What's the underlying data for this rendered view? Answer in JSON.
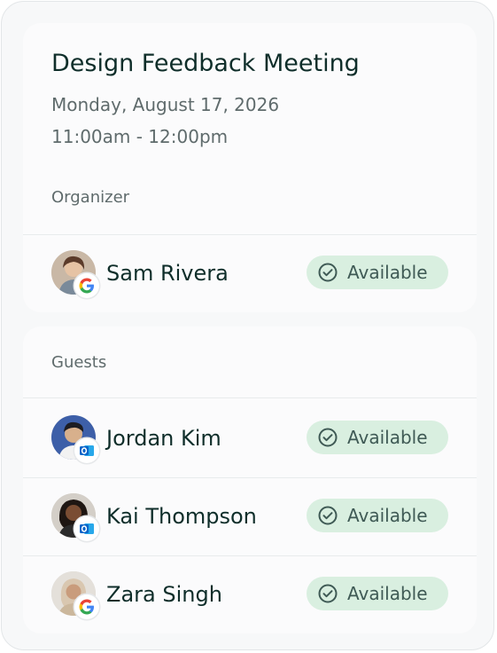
{
  "event": {
    "title": "Design Feedback Meeting",
    "date": "Monday, August 17, 2026",
    "time": "11:00am - 12:00pm"
  },
  "organizer": {
    "section_label": "Organizer",
    "person": {
      "name": "Sam Rivera",
      "provider_icon": "google-icon",
      "status": "Available"
    }
  },
  "guests": {
    "section_label": "Guests",
    "people": [
      {
        "name": "Jordan Kim",
        "provider_icon": "outlook-icon",
        "status": "Available"
      },
      {
        "name": "Kai Thompson",
        "provider_icon": "outlook-icon",
        "status": "Available"
      },
      {
        "name": "Zara Singh",
        "provider_icon": "google-icon",
        "status": "Available"
      }
    ]
  },
  "colors": {
    "status_bg": "#d9efe0",
    "title_text": "#0f2e2a",
    "muted_text": "#5f6b6c"
  }
}
